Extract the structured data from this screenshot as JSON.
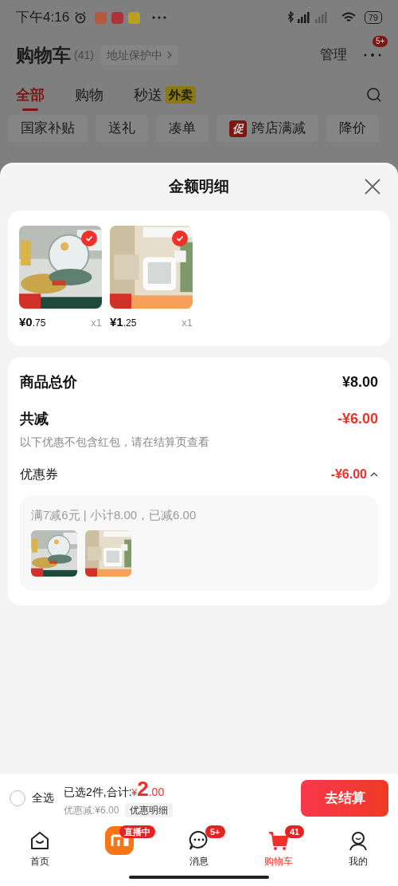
{
  "status_bar": {
    "time": "下午4:16",
    "battery": "79"
  },
  "header": {
    "title": "购物车",
    "count": "(41)",
    "address": "地址保护中",
    "manage": "管理",
    "badge": "5+"
  },
  "tabs": [
    {
      "label": "全部",
      "selected": true
    },
    {
      "label": "购物",
      "selected": false
    },
    {
      "label": "秒送",
      "selected": false,
      "tag": "外卖"
    }
  ],
  "chips": [
    {
      "label": "国家补贴"
    },
    {
      "label": "送礼"
    },
    {
      "label": "凑单"
    },
    {
      "label": "跨店满减",
      "tag": "促"
    },
    {
      "label": "降价"
    }
  ],
  "sheet": {
    "title": "金额明细",
    "items": [
      {
        "kind": "lid-rack",
        "checked": true,
        "price": "¥0",
        "cents": ".75",
        "qty": "x1"
      },
      {
        "kind": "thermometer",
        "checked": true,
        "price": "¥1",
        "cents": ".25",
        "qty": "x1"
      }
    ],
    "total_label": "商品总价",
    "total": "¥8.00",
    "discount_label": "共减",
    "discount": "-¥6.00",
    "note": "以下优惠不包含红包，请在结算页查看",
    "coupon_label": "优惠券",
    "coupon_value": "-¥6.00",
    "coupon_expanded": true,
    "coupon_detail": "满7减6元 | 小计8.00，已减6.00",
    "coupon_items": [
      {
        "kind": "lid-rack"
      },
      {
        "kind": "thermometer"
      }
    ]
  },
  "footer": {
    "select_all": {
      "label": "全选",
      "checked": false
    },
    "selected_text": "已选2件,合计:",
    "currency": "¥",
    "amount": "2",
    "cents": ".00",
    "saved": "优惠减:¥6.00",
    "details_button": "优惠明细",
    "checkout": "去结算"
  },
  "nav": [
    {
      "kind": "home",
      "label": "首页",
      "selected": false
    },
    {
      "kind": "live",
      "badge": "直播中",
      "selected": false
    },
    {
      "kind": "message",
      "label": "消息",
      "badge": "5+",
      "selected": false
    },
    {
      "kind": "cart",
      "label": "购物车",
      "badge": "41",
      "selected": true
    },
    {
      "kind": "profile",
      "label": "我的",
      "selected": false
    }
  ]
}
